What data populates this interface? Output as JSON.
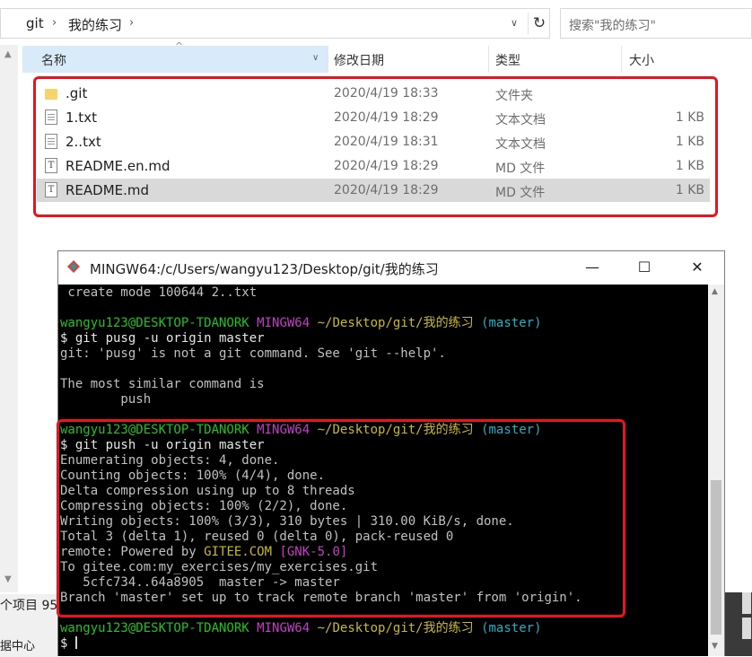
{
  "explorer": {
    "breadcrumbs": [
      "git",
      "我的练习"
    ],
    "search_placeholder": "搜索\"我的练习\"",
    "columns": {
      "name": "名称",
      "date": "修改日期",
      "type": "类型",
      "size": "大小"
    },
    "files": [
      {
        "name": ".git",
        "date": "2020/4/19 18:33",
        "type": "文件夹",
        "size": "",
        "icon": "folder-icon"
      },
      {
        "name": "1.txt",
        "date": "2020/4/19 18:29",
        "type": "文本文档",
        "size": "1 KB",
        "icon": "text-file-icon"
      },
      {
        "name": "2..txt",
        "date": "2020/4/19 18:31",
        "type": "文本文档",
        "size": "1 KB",
        "icon": "text-file-icon"
      },
      {
        "name": "README.en.md",
        "date": "2020/4/19 18:29",
        "type": "MD 文件",
        "size": "1 KB",
        "icon": "md-file-icon"
      },
      {
        "name": "README.md",
        "date": "2020/4/19 18:29",
        "type": "MD 文件",
        "size": "1 KB",
        "icon": "md-file-icon"
      }
    ],
    "selected_row": 4,
    "status_items": "个项目  95",
    "status_tail": "据中心"
  },
  "terminal": {
    "title": "MINGW64:/c/Users/wangyu123/Desktop/git/我的练习",
    "user_host": "wangyu123@DESKTOP-TDANORK",
    "shell": "MINGW64",
    "path": "~/Desktop/git/我的练习",
    "branch": "(master)",
    "first_line": " create mode 100644 2..txt",
    "cmd1": "$ git pusg -u origin master",
    "out1": [
      "git: 'pusg' is not a git command. See 'git --help'.",
      "",
      "The most similar command is",
      "        push"
    ],
    "cmd2": "$ git push -u origin master",
    "out2a": [
      "Enumerating objects: 4, done.",
      "Counting objects: 100% (4/4), done.",
      "Delta compression using up to 8 threads",
      "Compressing objects: 100% (2/2), done.",
      "Writing objects: 100% (3/3), 310 bytes | 310.00 KiB/s, done.",
      "Total 3 (delta 1), reused 0 (delta 0), pack-reused 0"
    ],
    "remote_prefix": "remote: Powered by ",
    "remote_host": "GITEE.COM",
    "remote_tag": "[GNK-5.0]",
    "out2b": [
      "To gitee.com:my_exercises/my_exercises.git",
      "   5cfc734..64a8905  master -> master",
      "Branch 'master' set up to track remote branch 'master' from 'origin'."
    ],
    "prompt_last": "$ "
  },
  "colors": {
    "highlight_red": "#e8151e",
    "term_green": "#1ec41e",
    "term_magenta": "#c53dc5",
    "term_yellow": "#c8b92a",
    "term_cyan": "#1cb1c8"
  }
}
